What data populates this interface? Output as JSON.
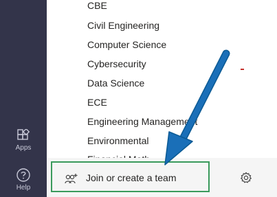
{
  "rail": {
    "items": [
      {
        "label": "Apps",
        "icon": "apps-icon"
      },
      {
        "label": "Help",
        "icon": "help-icon"
      }
    ]
  },
  "teams": {
    "items": [
      "CBE",
      "Civil Engineering",
      "Computer Science",
      "Cybersecurity",
      "Data Science",
      "ECE",
      "Engineering Management",
      "Environmental",
      "Financial Math"
    ]
  },
  "footer": {
    "join_label": "Join or create a team",
    "join_icon": "join-team-icon",
    "settings_icon": "gear-icon"
  },
  "colors": {
    "rail_bg": "#33344a",
    "highlight_border": "#3a9a5c",
    "annotation_arrow": "#1a6fb8",
    "notification_dot": "#c4302b"
  }
}
